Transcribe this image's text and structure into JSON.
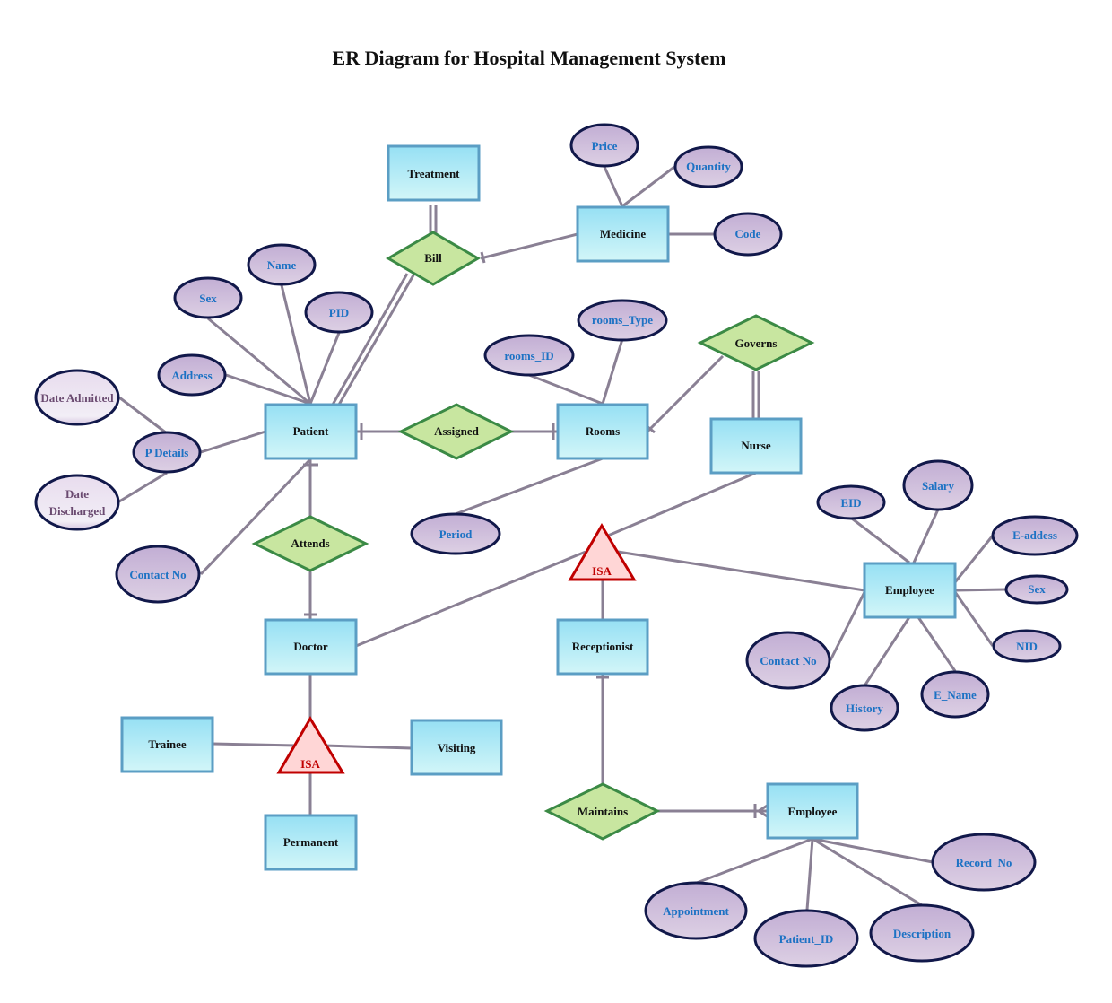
{
  "title": "ER Diagram for Hospital Management System",
  "colors": {
    "entity_stroke": "#5b9ec4",
    "entity_fill_top": "#96e0f4",
    "entity_fill_bottom": "#d2f6f8",
    "relationship_stroke": "#3b8a45",
    "relationship_fill": "#c8e6a0",
    "attribute_stroke": "#11184a",
    "attribute_fill_top": "#c2aed4",
    "attribute_fill_bottom": "#ddd0e4",
    "attribute_text": "#1c72c4",
    "isa_stroke": "#c00000",
    "isa_fill": "#ffd6d6",
    "connector": "#8a8094"
  },
  "entities": [
    {
      "id": "treatment",
      "label": "Treatment"
    },
    {
      "id": "medicine",
      "label": "Medicine"
    },
    {
      "id": "patient",
      "label": "Patient"
    },
    {
      "id": "rooms",
      "label": "Rooms"
    },
    {
      "id": "nurse",
      "label": "Nurse"
    },
    {
      "id": "employee",
      "label": "Employee"
    },
    {
      "id": "doctor",
      "label": "Doctor"
    },
    {
      "id": "receptionist",
      "label": "Receptionist"
    },
    {
      "id": "trainee",
      "label": "Trainee"
    },
    {
      "id": "visiting",
      "label": "Visiting"
    },
    {
      "id": "permanent",
      "label": "Permanent"
    },
    {
      "id": "employee2",
      "label": "Employee"
    }
  ],
  "relationships": [
    {
      "id": "bill",
      "label": "Bill"
    },
    {
      "id": "assigned",
      "label": "Assigned"
    },
    {
      "id": "governs",
      "label": "Governs"
    },
    {
      "id": "attends",
      "label": "Attends"
    },
    {
      "id": "maintains",
      "label": "Maintains"
    }
  ],
  "isa": [
    {
      "id": "isa1",
      "label": "ISA"
    },
    {
      "id": "isa2",
      "label": "ISA"
    }
  ],
  "attributes": [
    {
      "id": "price",
      "label": "Price",
      "of": "medicine"
    },
    {
      "id": "quantity",
      "label": "Quantity",
      "of": "medicine"
    },
    {
      "id": "code",
      "label": "Code",
      "of": "medicine"
    },
    {
      "id": "name",
      "label": "Name",
      "of": "patient"
    },
    {
      "id": "sex",
      "label": "Sex",
      "of": "patient"
    },
    {
      "id": "pid",
      "label": "PID",
      "of": "patient"
    },
    {
      "id": "address",
      "label": "Address",
      "of": "patient"
    },
    {
      "id": "pdetails",
      "label": "P Details",
      "of": "patient"
    },
    {
      "id": "date_admitted",
      "label": "Date Admitted",
      "of": "pdetails"
    },
    {
      "id": "date_discharged",
      "label": "Date Discharged",
      "of": "pdetails"
    },
    {
      "id": "contact_no_p",
      "label": "Contact No",
      "of": "patient"
    },
    {
      "id": "rooms_type",
      "label": "rooms_Type",
      "of": "rooms"
    },
    {
      "id": "rooms_id",
      "label": "rooms_ID",
      "of": "rooms"
    },
    {
      "id": "period",
      "label": "Period",
      "of": "rooms"
    },
    {
      "id": "eid",
      "label": "EID",
      "of": "employee"
    },
    {
      "id": "salary",
      "label": "Salary",
      "of": "employee"
    },
    {
      "id": "eaddress",
      "label": "E-addess",
      "of": "employee"
    },
    {
      "id": "sex_e",
      "label": "Sex",
      "of": "employee"
    },
    {
      "id": "nid",
      "label": "NID",
      "of": "employee"
    },
    {
      "id": "ename",
      "label": "E_Name",
      "of": "employee"
    },
    {
      "id": "history",
      "label": "History",
      "of": "employee"
    },
    {
      "id": "contact_no_e",
      "label": "Contact No",
      "of": "employee"
    },
    {
      "id": "record_no",
      "label": "Record_No",
      "of": "employee2"
    },
    {
      "id": "appointment",
      "label": "Appointment",
      "of": "employee2"
    },
    {
      "id": "patient_id",
      "label": "Patient_ID",
      "of": "employee2"
    },
    {
      "id": "description",
      "label": "Description",
      "of": "employee2"
    }
  ]
}
